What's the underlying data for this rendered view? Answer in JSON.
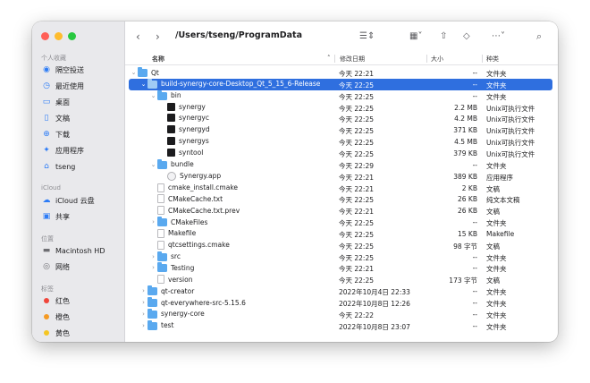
{
  "toolbar": {
    "path": "/Users/tseng/ProgramData"
  },
  "sidebar": {
    "favorites_title": "个人收藏",
    "favorites": [
      {
        "label": "隔空投送",
        "icon": "airdrop-icon"
      },
      {
        "label": "最近使用",
        "icon": "clock-icon"
      },
      {
        "label": "桌面",
        "icon": "desktop-icon"
      },
      {
        "label": "文稿",
        "icon": "document-icon"
      },
      {
        "label": "下载",
        "icon": "download-icon"
      },
      {
        "label": "应用程序",
        "icon": "applications-icon"
      },
      {
        "label": "tseng",
        "icon": "home-icon"
      }
    ],
    "icloud_title": "iCloud",
    "icloud": [
      {
        "label": "iCloud 云盘",
        "icon": "cloud-icon"
      },
      {
        "label": "共享",
        "icon": "shared-folder-icon"
      }
    ],
    "locations_title": "位置",
    "locations": [
      {
        "label": "Macintosh HD",
        "icon": "disk-icon"
      },
      {
        "label": "网络",
        "icon": "network-icon"
      }
    ],
    "tags_title": "标签",
    "tags": [
      {
        "label": "红色",
        "color": "#f0453a"
      },
      {
        "label": "橙色",
        "color": "#f59a23"
      },
      {
        "label": "黄色",
        "color": "#f5c623"
      }
    ]
  },
  "columns": {
    "name": "名称",
    "date": "修改日期",
    "size": "大小",
    "kind": "种类"
  },
  "files": [
    {
      "name": "Qt",
      "date": "今天 22:21",
      "size": "--",
      "kind": "文件夹",
      "type": "folder",
      "level": 0,
      "chev": "open"
    },
    {
      "name": "build-synergy-core-Desktop_Qt_5_15_6-Release",
      "date": "今天 22:25",
      "size": "--",
      "kind": "文件夹",
      "type": "folder",
      "level": 1,
      "chev": "open",
      "selected": true
    },
    {
      "name": "bin",
      "date": "今天 22:25",
      "size": "--",
      "kind": "文件夹",
      "type": "folder",
      "level": 2,
      "chev": "open"
    },
    {
      "name": "synergy",
      "date": "今天 22:25",
      "size": "2.2 MB",
      "kind": "Unix可执行文件",
      "type": "exec",
      "level": 3,
      "chev": "none"
    },
    {
      "name": "synergyc",
      "date": "今天 22:25",
      "size": "4.2 MB",
      "kind": "Unix可执行文件",
      "type": "exec",
      "level": 3,
      "chev": "none"
    },
    {
      "name": "synergyd",
      "date": "今天 22:25",
      "size": "371 KB",
      "kind": "Unix可执行文件",
      "type": "exec",
      "level": 3,
      "chev": "none"
    },
    {
      "name": "synergys",
      "date": "今天 22:25",
      "size": "4.5 MB",
      "kind": "Unix可执行文件",
      "type": "exec",
      "level": 3,
      "chev": "none"
    },
    {
      "name": "syntool",
      "date": "今天 22:25",
      "size": "379 KB",
      "kind": "Unix可执行文件",
      "type": "exec",
      "level": 3,
      "chev": "none"
    },
    {
      "name": "bundle",
      "date": "今天 22:29",
      "size": "--",
      "kind": "文件夹",
      "type": "folder",
      "level": 2,
      "chev": "open"
    },
    {
      "name": "Synergy.app",
      "date": "今天 22:21",
      "size": "389 KB",
      "kind": "应用程序",
      "type": "app",
      "level": 3,
      "chev": "none"
    },
    {
      "name": "cmake_install.cmake",
      "date": "今天 22:21",
      "size": "2 KB",
      "kind": "文稿",
      "type": "doc",
      "level": 2,
      "chev": "none"
    },
    {
      "name": "CMakeCache.txt",
      "date": "今天 22:25",
      "size": "26 KB",
      "kind": "纯文本文稿",
      "type": "doc",
      "level": 2,
      "chev": "none"
    },
    {
      "name": "CMakeCache.txt.prev",
      "date": "今天 22:21",
      "size": "26 KB",
      "kind": "文稿",
      "type": "doc",
      "level": 2,
      "chev": "none"
    },
    {
      "name": "CMakeFiles",
      "date": "今天 22:25",
      "size": "--",
      "kind": "文件夹",
      "type": "folder",
      "level": 2,
      "chev": "closed"
    },
    {
      "name": "Makefile",
      "date": "今天 22:25",
      "size": "15 KB",
      "kind": "Makefile",
      "type": "doc",
      "level": 2,
      "chev": "none"
    },
    {
      "name": "qtcsettings.cmake",
      "date": "今天 22:25",
      "size": "98 字节",
      "kind": "文稿",
      "type": "doc",
      "level": 2,
      "chev": "none"
    },
    {
      "name": "src",
      "date": "今天 22:25",
      "size": "--",
      "kind": "文件夹",
      "type": "folder",
      "level": 2,
      "chev": "closed"
    },
    {
      "name": "Testing",
      "date": "今天 22:21",
      "size": "--",
      "kind": "文件夹",
      "type": "folder",
      "level": 2,
      "chev": "closed"
    },
    {
      "name": "version",
      "date": "今天 22:25",
      "size": "173 字节",
      "kind": "文稿",
      "type": "doc",
      "level": 2,
      "chev": "none"
    },
    {
      "name": "qt-creator",
      "date": "2022年10月4日 22:33",
      "size": "--",
      "kind": "文件夹",
      "type": "folder",
      "level": 1,
      "chev": "closed"
    },
    {
      "name": "qt-everywhere-src-5.15.6",
      "date": "2022年10月8日 12:26",
      "size": "--",
      "kind": "文件夹",
      "type": "folder",
      "level": 1,
      "chev": "closed"
    },
    {
      "name": "synergy-core",
      "date": "今天 22:22",
      "size": "--",
      "kind": "文件夹",
      "type": "folder",
      "level": 1,
      "chev": "closed"
    },
    {
      "name": "test",
      "date": "2022年10月8日 23:07",
      "size": "--",
      "kind": "文件夹",
      "type": "folder",
      "level": 1,
      "chev": "closed"
    }
  ]
}
